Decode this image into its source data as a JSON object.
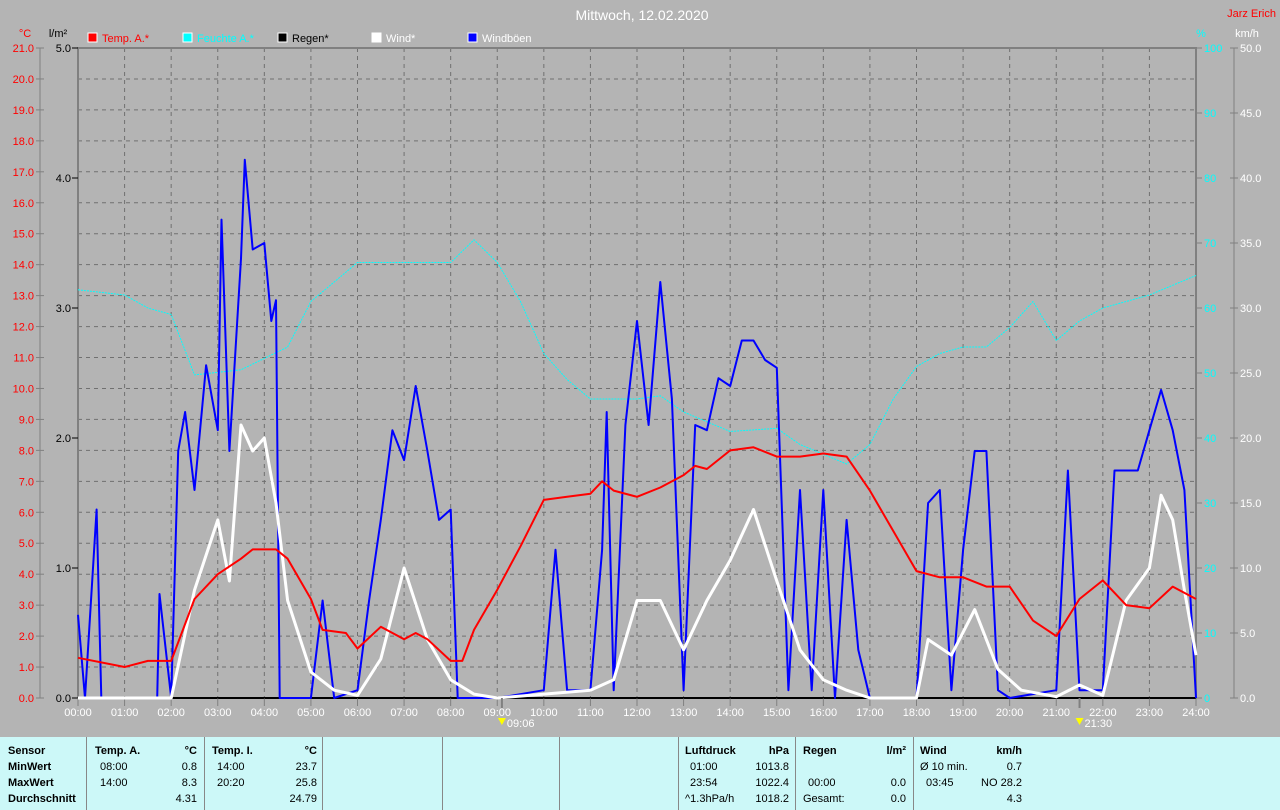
{
  "title": "Mittwoch, 12.02.2020",
  "author": "Jarz Erich",
  "colors": {
    "temp": "#ff0000",
    "humidity": "#00ffff",
    "rain": "#000000",
    "wind": "#ffffff",
    "gusts": "#0000ff",
    "background": "#b4b4b4",
    "table_bg": "#ccf8f8"
  },
  "chart_data": {
    "type": "line",
    "title": "Mittwoch, 12.02.2020",
    "x_ticks": [
      "00:00",
      "01:00",
      "02:00",
      "03:00",
      "04:00",
      "05:00",
      "06:00",
      "07:00",
      "08:00",
      "09:00",
      "10:00",
      "11:00",
      "12:00",
      "13:00",
      "14:00",
      "15:00",
      "16:00",
      "17:00",
      "18:00",
      "19:00",
      "20:00",
      "21:00",
      "22:00",
      "23:00",
      "24:00"
    ],
    "xlim": [
      0,
      24
    ],
    "axes": {
      "temp": {
        "unit": "°C",
        "range": [
          0,
          21
        ],
        "ticks": [
          "0.0",
          "1.0",
          "2.0",
          "3.0",
          "4.0",
          "5.0",
          "6.0",
          "7.0",
          "8.0",
          "9.0",
          "10.0",
          "11.0",
          "12.0",
          "13.0",
          "14.0",
          "15.0",
          "16.0",
          "17.0",
          "18.0",
          "19.0",
          "20.0",
          "21.0"
        ]
      },
      "rain": {
        "unit": "l/m²",
        "range": [
          0,
          5
        ],
        "ticks": [
          "0.0",
          "1.0",
          "2.0",
          "3.0",
          "4.0",
          "5.0"
        ]
      },
      "humidity": {
        "unit": "%",
        "range": [
          0,
          100
        ],
        "ticks": [
          "0",
          "10",
          "20",
          "30",
          "40",
          "50",
          "60",
          "70",
          "80",
          "90",
          "100"
        ]
      },
      "wind": {
        "unit": "km/h",
        "range": [
          0,
          50
        ],
        "ticks": [
          "0.0",
          "5.0",
          "10.0",
          "15.0",
          "20.0",
          "25.0",
          "30.0",
          "35.0",
          "40.0",
          "45.0",
          "50.0"
        ]
      }
    },
    "legend": [
      "Temp. A.*",
      "Feuchte A.*",
      "Regen*",
      "Wind*",
      "Windböen"
    ],
    "legend_placement": "top",
    "sun_markers": [
      {
        "label": "09:06",
        "time": 9.1
      },
      {
        "label": "21:30",
        "time": 21.5
      }
    ],
    "series": [
      {
        "name": "Temp. A.",
        "axis": "temp",
        "points": [
          [
            0,
            1.3
          ],
          [
            1,
            1.0
          ],
          [
            1.5,
            1.2
          ],
          [
            2,
            1.2
          ],
          [
            2.5,
            3.2
          ],
          [
            3,
            4.0
          ],
          [
            3.5,
            4.5
          ],
          [
            3.75,
            4.8
          ],
          [
            4.25,
            4.8
          ],
          [
            4.5,
            4.5
          ],
          [
            5,
            3.2
          ],
          [
            5.25,
            2.2
          ],
          [
            5.75,
            2.1
          ],
          [
            6,
            1.6
          ],
          [
            6.5,
            2.3
          ],
          [
            7,
            1.9
          ],
          [
            7.25,
            2.1
          ],
          [
            7.5,
            1.9
          ],
          [
            8,
            1.2
          ],
          [
            8.25,
            1.2
          ],
          [
            8.5,
            2.2
          ],
          [
            9,
            3.5
          ],
          [
            9.5,
            4.9
          ],
          [
            10,
            6.4
          ],
          [
            10.5,
            6.5
          ],
          [
            11,
            6.6
          ],
          [
            11.25,
            7.0
          ],
          [
            11.5,
            6.7
          ],
          [
            12,
            6.5
          ],
          [
            12.5,
            6.8
          ],
          [
            13,
            7.2
          ],
          [
            13.25,
            7.5
          ],
          [
            13.5,
            7.4
          ],
          [
            14,
            8.0
          ],
          [
            14.5,
            8.1
          ],
          [
            15,
            7.8
          ],
          [
            15.5,
            7.8
          ],
          [
            16,
            7.9
          ],
          [
            16.5,
            7.8
          ],
          [
            17,
            6.7
          ],
          [
            17.5,
            5.4
          ],
          [
            18,
            4.1
          ],
          [
            18.5,
            3.9
          ],
          [
            19,
            3.9
          ],
          [
            19.5,
            3.6
          ],
          [
            20,
            3.6
          ],
          [
            20.5,
            2.5
          ],
          [
            21,
            2.0
          ],
          [
            21.5,
            3.2
          ],
          [
            22,
            3.8
          ],
          [
            22.5,
            3.0
          ],
          [
            23,
            2.9
          ],
          [
            23.5,
            3.6
          ],
          [
            24,
            3.2
          ]
        ]
      },
      {
        "name": "Feuchte A.",
        "axis": "humidity",
        "points": [
          [
            0,
            62.8
          ],
          [
            1,
            62
          ],
          [
            1.5,
            60
          ],
          [
            2,
            59
          ],
          [
            2.5,
            49.7
          ],
          [
            3.5,
            50.5
          ],
          [
            4.5,
            54
          ],
          [
            5,
            61
          ],
          [
            5.5,
            64
          ],
          [
            6,
            67
          ],
          [
            7,
            67
          ],
          [
            8,
            67
          ],
          [
            8.5,
            70.5
          ],
          [
            9,
            67
          ],
          [
            9.5,
            61
          ],
          [
            10,
            53
          ],
          [
            10.5,
            49
          ],
          [
            11,
            46
          ],
          [
            12,
            46
          ],
          [
            12.5,
            46.5
          ],
          [
            13,
            44
          ],
          [
            14,
            41
          ],
          [
            15,
            41.5
          ],
          [
            15.5,
            39
          ],
          [
            16.5,
            36
          ],
          [
            17,
            39
          ],
          [
            17.5,
            46
          ],
          [
            18,
            51
          ],
          [
            18.5,
            53
          ],
          [
            19,
            54
          ],
          [
            19.5,
            54
          ],
          [
            20,
            57
          ],
          [
            20.5,
            61
          ],
          [
            21,
            55
          ],
          [
            21.5,
            58
          ],
          [
            22,
            60
          ],
          [
            23,
            62
          ],
          [
            24,
            65
          ]
        ]
      },
      {
        "name": "Regen",
        "axis": "rain",
        "points": [
          [
            0,
            0
          ],
          [
            24,
            0
          ]
        ]
      },
      {
        "name": "Wind",
        "axis": "wind",
        "points": [
          [
            0,
            0
          ],
          [
            2,
            0
          ],
          [
            2.5,
            8.3
          ],
          [
            3,
            13.7
          ],
          [
            3.25,
            9
          ],
          [
            3.5,
            21
          ],
          [
            3.75,
            19
          ],
          [
            4,
            20
          ],
          [
            4.25,
            15
          ],
          [
            4.5,
            7.5
          ],
          [
            5,
            2
          ],
          [
            5.5,
            0.6
          ],
          [
            6,
            0.2
          ],
          [
            6.5,
            3
          ],
          [
            7,
            10
          ],
          [
            7.5,
            4.5
          ],
          [
            8,
            1.4
          ],
          [
            8.5,
            0.3
          ],
          [
            9,
            0
          ],
          [
            11,
            0.6
          ],
          [
            11.5,
            1.4
          ],
          [
            12,
            7.5
          ],
          [
            12.5,
            7.5
          ],
          [
            13,
            3.7
          ],
          [
            13.5,
            7.5
          ],
          [
            14,
            10.6
          ],
          [
            14.5,
            14.5
          ],
          [
            15,
            9
          ],
          [
            15.5,
            3.7
          ],
          [
            16,
            1.4
          ],
          [
            16.5,
            0.6
          ],
          [
            17,
            0
          ],
          [
            18,
            0
          ],
          [
            18.25,
            4.5
          ],
          [
            18.75,
            3.3
          ],
          [
            19.25,
            6.8
          ],
          [
            19.75,
            2.2
          ],
          [
            20.25,
            0.6
          ],
          [
            21,
            0.1
          ],
          [
            21.5,
            1
          ],
          [
            22,
            0.2
          ],
          [
            22.5,
            7.5
          ],
          [
            23,
            10
          ],
          [
            23.25,
            15.6
          ],
          [
            23.5,
            13.7
          ],
          [
            23.75,
            8.3
          ],
          [
            24,
            3.3
          ]
        ]
      },
      {
        "name": "Windböen",
        "axis": "wind",
        "points": [
          [
            0,
            6.4
          ],
          [
            0.15,
            0
          ],
          [
            0.4,
            14.5
          ],
          [
            0.5,
            0
          ],
          [
            1.7,
            0
          ],
          [
            1.75,
            8
          ],
          [
            2,
            0
          ],
          [
            2.15,
            19
          ],
          [
            2.3,
            22
          ],
          [
            2.5,
            16
          ],
          [
            2.75,
            25.6
          ],
          [
            3,
            20.6
          ],
          [
            3.08,
            36.8
          ],
          [
            3.25,
            19
          ],
          [
            3.5,
            33.8
          ],
          [
            3.58,
            41.4
          ],
          [
            3.75,
            34.5
          ],
          [
            4,
            35
          ],
          [
            4.15,
            29
          ],
          [
            4.25,
            30.6
          ],
          [
            4.33,
            0
          ],
          [
            5,
            0
          ],
          [
            5.25,
            7.5
          ],
          [
            5.5,
            0
          ],
          [
            6,
            0.6
          ],
          [
            6.25,
            7.5
          ],
          [
            6.5,
            13.7
          ],
          [
            6.75,
            20.6
          ],
          [
            7,
            18.3
          ],
          [
            7.25,
            24
          ],
          [
            7.5,
            19
          ],
          [
            7.75,
            13.7
          ],
          [
            8,
            14.5
          ],
          [
            8.15,
            0
          ],
          [
            9,
            0
          ],
          [
            10,
            0.6
          ],
          [
            10.25,
            11.4
          ],
          [
            10.5,
            0.6
          ],
          [
            11,
            0.6
          ],
          [
            11.25,
            11.4
          ],
          [
            11.35,
            22
          ],
          [
            11.5,
            0.6
          ],
          [
            11.75,
            21
          ],
          [
            12,
            29
          ],
          [
            12.25,
            21
          ],
          [
            12.5,
            32
          ],
          [
            12.75,
            23
          ],
          [
            13,
            0.6
          ],
          [
            13.25,
            21
          ],
          [
            13.5,
            20.6
          ],
          [
            13.75,
            24.6
          ],
          [
            14,
            24
          ],
          [
            14.25,
            27.5
          ],
          [
            14.5,
            27.5
          ],
          [
            14.75,
            26
          ],
          [
            15,
            25.4
          ],
          [
            15.25,
            0.6
          ],
          [
            15.5,
            16
          ],
          [
            15.75,
            0.6
          ],
          [
            16,
            16
          ],
          [
            16.25,
            0
          ],
          [
            16.5,
            13.7
          ],
          [
            16.75,
            3.7
          ],
          [
            17,
            0
          ],
          [
            18,
            0
          ],
          [
            18.25,
            15
          ],
          [
            18.5,
            16
          ],
          [
            18.75,
            0.6
          ],
          [
            19,
            11.4
          ],
          [
            19.25,
            19
          ],
          [
            19.5,
            19
          ],
          [
            19.75,
            0.6
          ],
          [
            20,
            0
          ],
          [
            21,
            0.6
          ],
          [
            21.25,
            17.5
          ],
          [
            21.5,
            0.6
          ],
          [
            22,
            0.6
          ],
          [
            22.25,
            17.5
          ],
          [
            22.75,
            17.5
          ],
          [
            23,
            20.6
          ],
          [
            23.25,
            23.7
          ],
          [
            23.5,
            20.6
          ],
          [
            23.75,
            16
          ],
          [
            24,
            0
          ]
        ]
      }
    ]
  },
  "table": {
    "sensor": {
      "header": "Sensor",
      "rows": [
        "MinWert",
        "MaxWert",
        "Durchschnitt"
      ]
    },
    "temp_a": {
      "header": "Temp. A.",
      "unit": "°C",
      "min_time": "08:00",
      "min": "0.8",
      "max_time": "14:00",
      "max": "8.3",
      "avg": "4.31"
    },
    "temp_i": {
      "header": "Temp. I.",
      "unit": "°C",
      "min_time": "14:00",
      "min": "23.7",
      "max_time": "20:20",
      "max": "25.8",
      "avg": "24.79"
    },
    "pressure": {
      "header": "Luftdruck",
      "unit": "hPa",
      "min_time": "01:00",
      "min": "1013.8",
      "max_time": "23:54",
      "max": "1022.4",
      "trend": "^1.3hPa/h",
      "avg": "1018.2"
    },
    "rain": {
      "header": "Regen",
      "unit": "l/m²",
      "time": "00:00",
      "value": "0.0",
      "total_label": "Gesamt:",
      "total": "0.0"
    },
    "wind": {
      "header": "Wind",
      "unit": "km/h",
      "avg_label": "Ø 10 min.",
      "avg10": "0.7",
      "max_time": "03:45",
      "max": "NO 28.2",
      "avg": "4.3"
    }
  }
}
